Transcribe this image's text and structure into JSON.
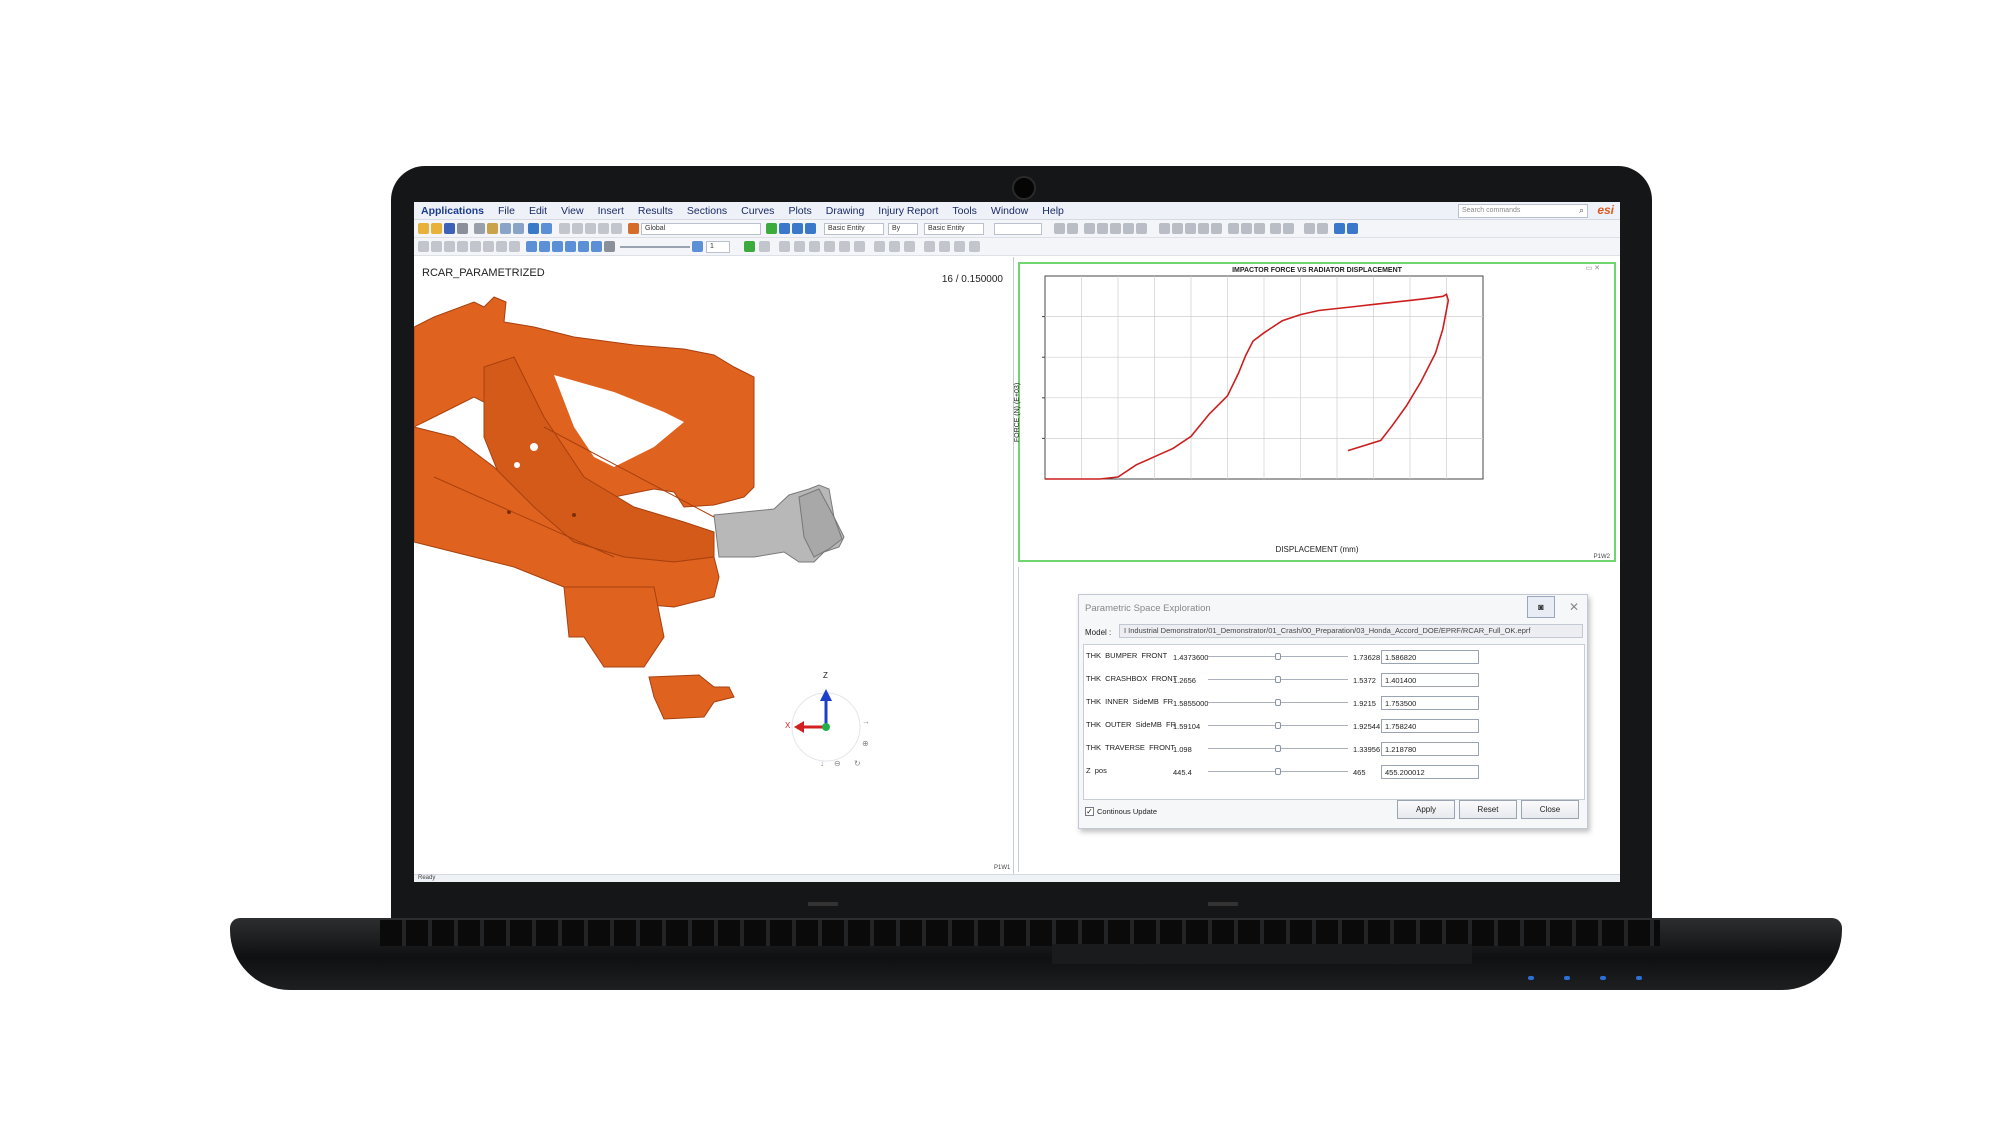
{
  "menu": {
    "items": [
      "Applications",
      "File",
      "Edit",
      "View",
      "Insert",
      "Results",
      "Sections",
      "Curves",
      "Plots",
      "Drawing",
      "Injury Report",
      "Tools",
      "Window",
      "Help"
    ],
    "search_placeholder": "Search commands",
    "search_icon": "search-icon",
    "logo_text": "esi"
  },
  "toolbar": {
    "coord_system": "Global",
    "entity_type_1": "Basic Entity",
    "by_label": "By",
    "entity_type_2": "Basic Entity",
    "step_value": "1"
  },
  "viewport": {
    "model_name": "RCAR_PARAMETRIZED",
    "frame_info": "16 / 0.150000",
    "window_tag": "P1W1",
    "axis_z": "Z",
    "axis_x": "X",
    "body_color": "#e0621f",
    "part_color": "#b8b8b8"
  },
  "chart_panel": {
    "window_tag": "P1W2",
    "frame_color": "#6fd66f"
  },
  "chart_data": {
    "type": "line",
    "title": "IMPACTOR FORCE VS RADIATOR DISPLACEMENT",
    "xlabel": "DISPLACEMENT (mm)",
    "ylabel": "FORCE (N) (E+03)",
    "xlim": [
      0,
      12
    ],
    "ylim": [
      0,
      5
    ],
    "grid": true,
    "series": [
      {
        "color": "#cc1e1e",
        "x": [
          0,
          1.0,
          1.5,
          2.0,
          2.5,
          3.0,
          3.5,
          4.0,
          4.5,
          5.0,
          5.3,
          5.5,
          5.7,
          6.0,
          6.5,
          7.0,
          7.5,
          8.0,
          8.5,
          9.0,
          9.5,
          10.0,
          10.5,
          10.9,
          11.0,
          11.05,
          10.9,
          10.7,
          10.3,
          9.9,
          9.5,
          9.2,
          8.3
        ],
        "y": [
          0,
          0,
          0,
          0.05,
          0.35,
          0.55,
          0.75,
          1.05,
          1.6,
          2.05,
          2.6,
          3.05,
          3.4,
          3.6,
          3.9,
          4.05,
          4.15,
          4.2,
          4.25,
          4.3,
          4.35,
          4.4,
          4.45,
          4.5,
          4.55,
          4.4,
          3.7,
          3.1,
          2.4,
          1.8,
          1.3,
          0.95,
          0.7
        ]
      }
    ]
  },
  "dialog": {
    "title": "Parametric Space Exploration",
    "model_label": "Model :",
    "model_path": "I Industrial Demonstrator/01_Demonstrator/01_Crash/00_Preparation/03_Honda_Accord_DOE/EPRF/RCAR_Full_OK.eprf",
    "pin_icon": "pin-icon",
    "close_icon": "close-icon",
    "params": [
      {
        "name": "THK  BUMPER  FRONT",
        "min": "1.4373600",
        "max": "1.73628",
        "value": "1.586820",
        "level": 0.5
      },
      {
        "name": "THK  CRASHBOX  FRONT",
        "min": "1.2656",
        "max": "1.5372",
        "value": "1.401400",
        "level": 0.5
      },
      {
        "name": "THK  INNER  SideMB  FR",
        "min": "1.5855000",
        "max": "1.9215",
        "value": "1.753500",
        "level": 0.5
      },
      {
        "name": "THK  OUTER  SideMB  FR",
        "min": "1.59104",
        "max": "1.92544",
        "value": "1.758240",
        "level": 0.5
      },
      {
        "name": "THK  TRAVERSE  FRONT",
        "min": "1.098",
        "max": "1.33956",
        "value": "1.218780",
        "level": 0.5
      },
      {
        "name": "Z  pos",
        "min": "445.4",
        "max": "465",
        "value": "455.200012",
        "level": 0.5
      }
    ],
    "continuous_update_label": "Continous Update",
    "continuous_update_checked": true,
    "apply_label": "Apply",
    "reset_label": "Reset",
    "close_label": "Close"
  },
  "status": {
    "text": "Ready"
  }
}
